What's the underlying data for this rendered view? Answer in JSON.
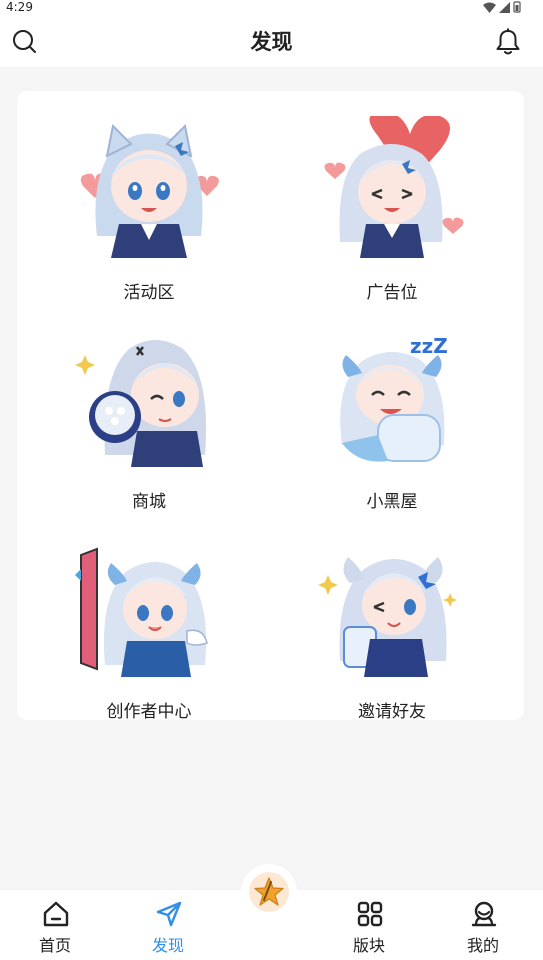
{
  "status": {
    "time": "4:29"
  },
  "header": {
    "title": "发现"
  },
  "features": [
    {
      "label": "活动区",
      "icon": "chibi-girl-hearts-image"
    },
    {
      "label": "广告位",
      "icon": "chibi-girl-balloon-image"
    },
    {
      "label": "商城",
      "icon": "chibi-girl-bouquet-image"
    },
    {
      "label": "小黑屋",
      "icon": "chibi-girl-sleeping-image"
    },
    {
      "label": "创作者中心",
      "icon": "chibi-girl-door-image"
    },
    {
      "label": "邀请好友",
      "icon": "chibi-girl-wink-image"
    }
  ],
  "bottom_nav": [
    {
      "label": "首页",
      "icon": "home-icon"
    },
    {
      "label": "发现",
      "icon": "send-icon",
      "active": true
    },
    {
      "label": "版块",
      "icon": "grid-icon"
    },
    {
      "label": "我的",
      "icon": "user-icon"
    }
  ],
  "colors": {
    "accent": "#2f8fea",
    "fab_star": "#f2a12b"
  }
}
